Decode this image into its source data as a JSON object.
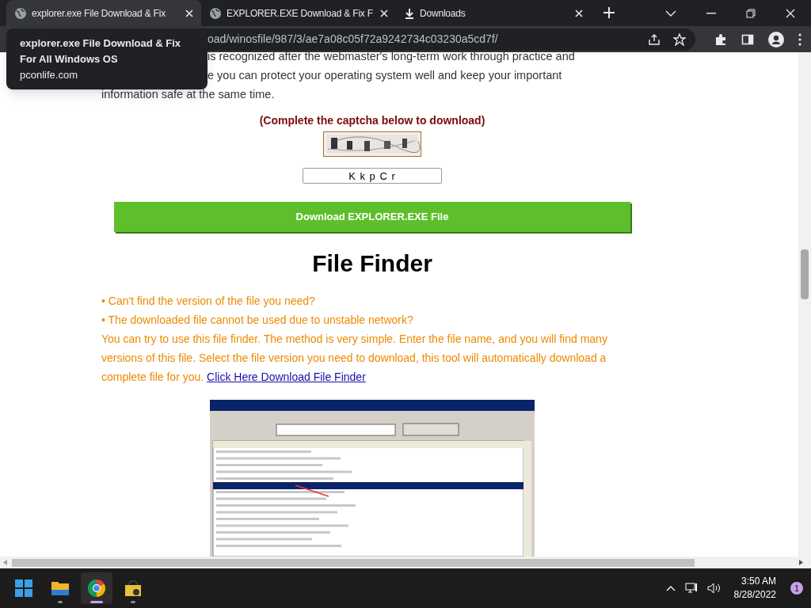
{
  "browser": {
    "tabs": [
      {
        "kind": "page",
        "title": "explorer.exe File Download & Fix",
        "selected": true
      },
      {
        "kind": "page",
        "title": "EXPLORER.EXE Download & Fix F",
        "selected": false
      },
      {
        "kind": "downloads",
        "title": "Downloads",
        "selected": false
      }
    ],
    "address": "oad/winosfile/987/3/ae7a08c05f72a9242734c03230a5cd7f/",
    "tooltip": {
      "title": "explorer.exe File Download & Fix For All Windows OS",
      "host": "pconlife.com"
    }
  },
  "page": {
    "intro_lines": [
      "is recognized after the webmaster's long-term work through practice and",
      "e you can protect your operating system well and keep your important",
      "information safe at the same time."
    ],
    "captcha": {
      "prompt": "(Complete the captcha below to download)",
      "value": "K k p C r"
    },
    "download_button": "Download EXPLORER.EXE File",
    "heading": "File Finder",
    "bullets": [
      "• Can't find the version of the file you need?",
      "• The downloaded file cannot be used due to unstable network?"
    ],
    "paragraph": "You can try to use this file finder. The method is very simple. Enter the file name, and you will find many versions of this file. Select the file version you need to download, this tool will automatically download a complete file for you.",
    "link": "Click Here Download File Finder",
    "finder": {
      "kind": "picture"
    }
  },
  "taskbar": {
    "apps": [
      {
        "kind": "start",
        "active": false,
        "running": false
      },
      {
        "kind": "folder",
        "active": false,
        "running": true
      },
      {
        "kind": "chrome",
        "active": true,
        "running": true
      },
      {
        "kind": "package",
        "active": false,
        "running": true
      }
    ],
    "time": "3:50 AM",
    "date": "8/28/2022",
    "notifications": "1"
  }
}
